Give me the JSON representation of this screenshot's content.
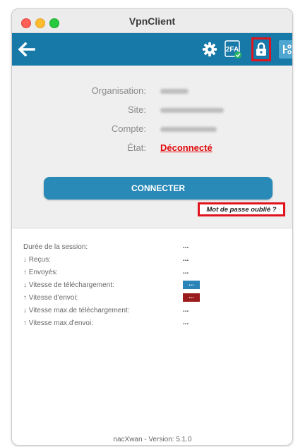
{
  "window": {
    "title": "VpnClient"
  },
  "toolbar": {
    "icons": [
      "back-arrow-icon",
      "gear-icon",
      "2fa-icon",
      "lock-icon",
      "route-icon"
    ],
    "twofa_text": "2FA",
    "accent_color": "#1779a8",
    "highlight_color": "#e0141e"
  },
  "status": {
    "organisation_label": "Organisation:",
    "site_label": "Site:",
    "compte_label": "Compte:",
    "etat_label": "État:",
    "etat_value": "Déconnecté",
    "etat_color": "#e10a0a"
  },
  "connect": {
    "label": "CONNECTER"
  },
  "forgot": {
    "label": "Mot de passe oublié ?"
  },
  "stats": [
    {
      "label": "Durée de la session:",
      "value": "..."
    },
    {
      "label": "↓ Reçus:",
      "value": "..."
    },
    {
      "label": "↑ Envoyés:",
      "value": "..."
    },
    {
      "label": "↓ Vitesse de téléchargement:",
      "value": "...",
      "style": "blue"
    },
    {
      "label": "↑ Vitesse d'envoi:",
      "value": "...",
      "style": "red"
    },
    {
      "label": "↓ Vitesse max.de téléchargement:",
      "value": "..."
    },
    {
      "label": "↑ Vitesse max.d'envoi:",
      "value": "..."
    }
  ],
  "footer": {
    "version_text": "nacXwan - Version: 5.1.0"
  }
}
